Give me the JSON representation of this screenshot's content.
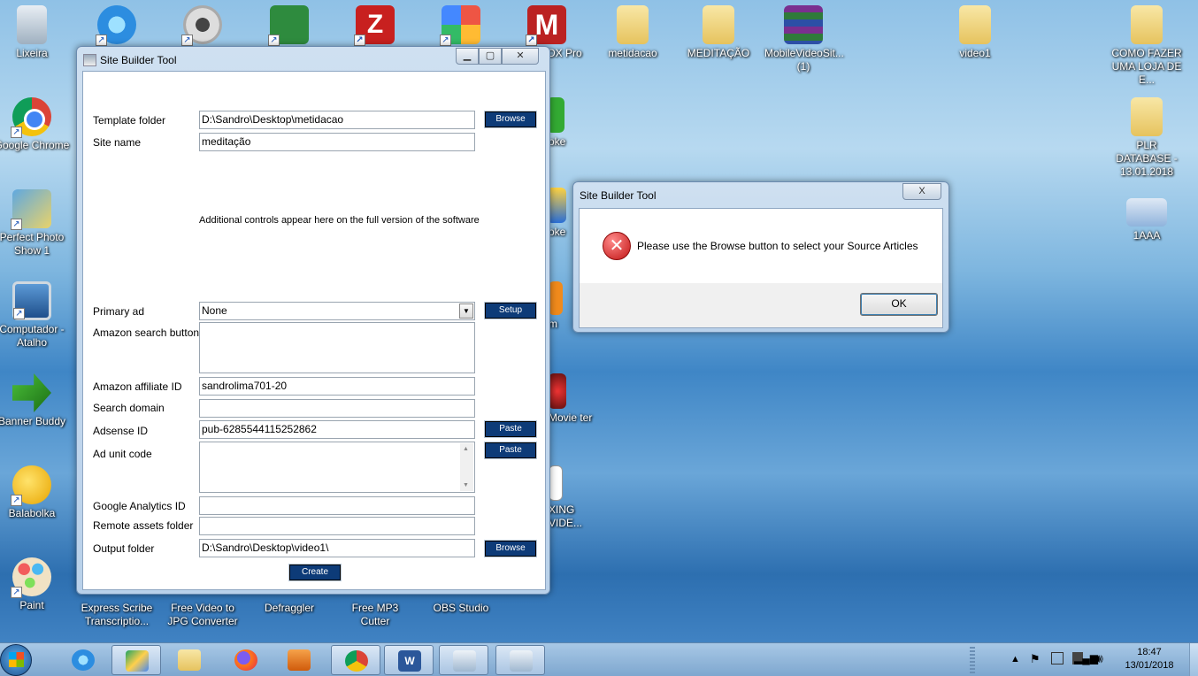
{
  "desktop": {
    "icons": [
      {
        "label": "Lixeira"
      },
      {
        "label": "Google Chrome"
      },
      {
        "label": "Perfect Photo Show 1"
      },
      {
        "label": "Computador - Atalho"
      },
      {
        "label": "Banner Buddy"
      },
      {
        "label": "Balabolka"
      },
      {
        "label": "Paint"
      },
      {
        "label": "Express Scribe Transcriptio..."
      },
      {
        "label": "Free Video to JPG Converter"
      },
      {
        "label": "Defraggler"
      },
      {
        "label": "Free MP3 Cutter"
      },
      {
        "label": "OBS Studio"
      },
      {
        "label": "OX Pro"
      },
      {
        "label": "metidacao"
      },
      {
        "label": "MEDITAÇÃO"
      },
      {
        "label": "MobileVideoSit... (1)"
      },
      {
        "label": "video1"
      },
      {
        "label": "COMO FAZER UMA LOJA DE E..."
      },
      {
        "label": "PLR DATABASE - 13.01.2018"
      },
      {
        "label": "1AAA"
      },
      {
        "label": "oke"
      },
      {
        "label": "oke"
      },
      {
        "label": "m"
      },
      {
        "label": "Movie ter"
      },
      {
        "label": "XING VIDE..."
      }
    ]
  },
  "main_window": {
    "title": "Site Builder Tool",
    "template_folder": {
      "label": "Template folder",
      "value": "D:\\Sandro\\Desktop\\metidacao",
      "button": "Browse"
    },
    "site_name": {
      "label": "Site name",
      "value": "meditação"
    },
    "notice": "Additional controls appear here on the full version of the software",
    "primary_ad": {
      "label": "Primary ad",
      "value": "None",
      "button": "Setup"
    },
    "amazon_search": {
      "label": "Amazon search buttons",
      "value": ""
    },
    "amazon_affiliate": {
      "label": "Amazon affiliate ID",
      "value": "sandrolima701-20"
    },
    "search_domain": {
      "label": "Search domain",
      "value": ""
    },
    "adsense": {
      "label": "Adsense ID",
      "value": "pub-6285544115252862",
      "button": "Paste"
    },
    "ad_unit": {
      "label": "Ad unit code",
      "value": "",
      "button": "Paste"
    },
    "google_analytics": {
      "label": "Google Analytics ID",
      "value": ""
    },
    "remote_assets": {
      "label": "Remote assets folder",
      "value": ""
    },
    "output_folder": {
      "label": "Output folder",
      "value": "D:\\Sandro\\Desktop\\video1\\",
      "button": "Browse"
    },
    "create_button": "Create"
  },
  "message_box": {
    "title": "Site Builder Tool",
    "message": "Please use the Browse button to select your Source Articles",
    "ok": "OK",
    "close_glyph": "X"
  },
  "taskbar": {
    "time": "18:47",
    "date": "13/01/2018",
    "items": [
      "firefox",
      "internet-explorer",
      "google-drive",
      "file-explorer",
      "firefox",
      "vlc",
      "chrome",
      "word",
      "site-builder-1",
      "site-builder-2"
    ]
  },
  "colors": {
    "button_blue": "#0d3b78",
    "error_red": "#c11414"
  }
}
